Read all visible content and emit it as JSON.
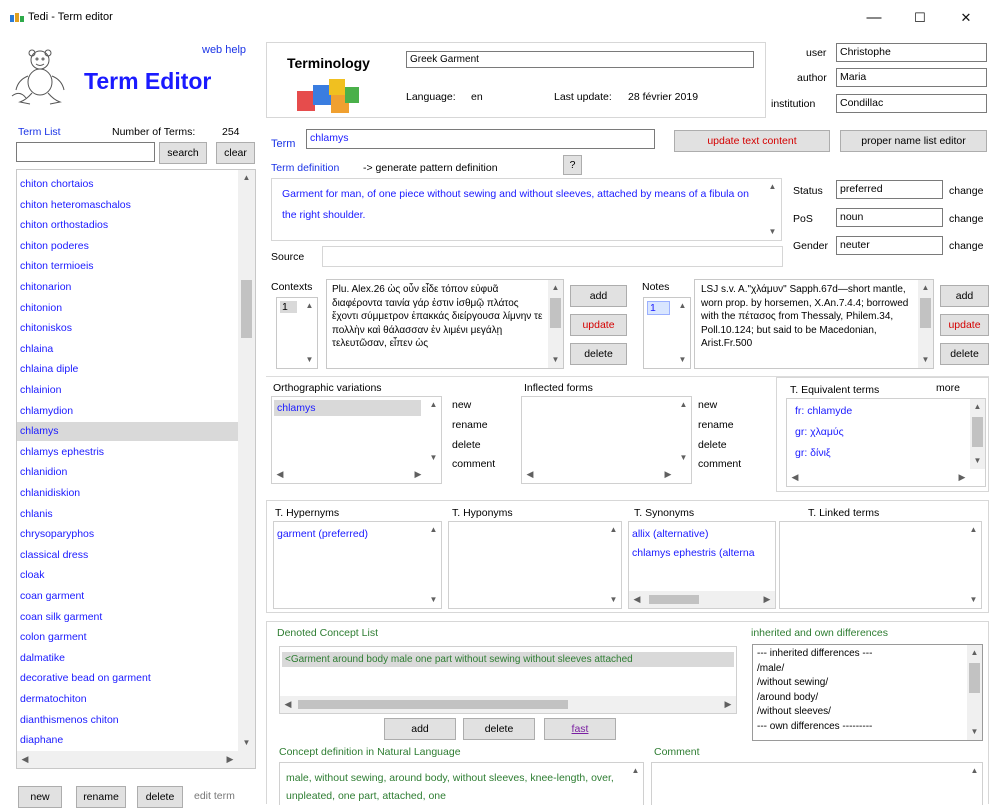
{
  "window": {
    "title": "Tedi - Term editor",
    "minimize": "—",
    "maximize": "☐",
    "close": "✕"
  },
  "left": {
    "web_help": "web help",
    "heading": "Term Editor",
    "term_list_label": "Term List",
    "number_of_terms_label": "Number of Terms:",
    "number_of_terms": "254",
    "search_value": "",
    "search_button": "search",
    "clear_button": "clear",
    "terms": [
      "chiton chortaios",
      "chiton heteromaschalos",
      "chiton orthostadios",
      "chiton poderes",
      "chiton termioeis",
      "chitonarion",
      "chitonion",
      "chitoniskos",
      "chlaina",
      "chlaina diple",
      "chlainion",
      "chlamydion",
      "chlamys",
      "chlamys ephestris",
      "chlanidion",
      "chlanidiskion",
      "chlanis",
      "chrysoparyphos",
      "classical dress",
      "cloak",
      "coan garment",
      "coan silk garment",
      "colon garment",
      "dalmatike",
      "decorative bead on garment",
      "dermatochiton",
      "dianthismenos chiton",
      "diaphane"
    ],
    "selected_index": 12,
    "new_button": "new",
    "rename_button": "rename",
    "delete_button": "delete",
    "edit_term": "edit term"
  },
  "header": {
    "terminology_label": "Terminology",
    "terminology_value": "Greek Garment",
    "language_label": "Language:",
    "language_value": "en",
    "last_update_label": "Last update:",
    "last_update_value": "28 février 2019",
    "user_label": "user",
    "user_value": "Christophe",
    "author_label": "author",
    "author_value": "Maria",
    "institution_label": "institution",
    "institution_value": "Condillac"
  },
  "term": {
    "term_label": "Term",
    "term_value": "chlamys",
    "update_text_button": "update text content",
    "proper_name_button": "proper name list editor",
    "definition_label": "Term definition",
    "generate_pattern": "-> generate pattern definition",
    "help_button": "?",
    "definition_text": "Garment for man, of one piece without sewing and without sleeves, attached by means of a fibula on the right shoulder.",
    "status_label": "Status",
    "status_value": "preferred",
    "pos_label": "PoS",
    "pos_value": "noun",
    "gender_label": "Gender",
    "gender_value": "neuter",
    "change_label": "change",
    "source_label": "Source",
    "source_value": ""
  },
  "contexts": {
    "label": "Contexts",
    "index": "1",
    "text": "Plu. Alex.26 ὡς οὖν εἶδε τόπον εὐφυᾶ διαφέροντα ταινία γάρ ἐστιν ἰσθμῷ πλάτος ἔχοντι σύμμετρον ἐπακκάς διείργουσα λίμνην τε πολλὴν καὶ θάλασσαν ἐν λιμένι μεγάλῃ τελευτῶσαν, εἶπεν ὡς",
    "add": "add",
    "update": "update",
    "delete": "delete"
  },
  "notes": {
    "label": "Notes",
    "index": "1",
    "text": "LSJ s.v. A.\"χλάμυν\" Sapph.67d—short mantle, worn prop. by horsemen, X.An.7.4.4; borrowed with the πέτασος from Thessaly, Philem.34, Poll.10.124; but said to be Macedonian, Arist.Fr.500",
    "add": "add",
    "update": "update",
    "delete": "delete"
  },
  "ortho": {
    "label": "Orthographic variations",
    "items": [
      "chlamys"
    ],
    "new": "new",
    "rename": "rename",
    "delete": "delete",
    "comment": "comment"
  },
  "inflected": {
    "label": "Inflected forms",
    "new": "new",
    "rename": "rename",
    "delete": "delete",
    "comment": "comment"
  },
  "equivalents": {
    "label": "T. Equivalent terms",
    "more": "more",
    "items": [
      "fr: chlamyde",
      "gr: χλαμύς",
      "gr: δίνιξ"
    ]
  },
  "relations": {
    "hypernyms_label": "T. Hypernyms",
    "hypernyms": [
      "garment (preferred)"
    ],
    "hyponyms_label": "T. Hyponyms",
    "synonyms_label": "T. Synonyms",
    "synonyms": [
      "allix (alternative)",
      "chlamys ephestris (alterna"
    ],
    "linked_label": "T. Linked terms"
  },
  "concept": {
    "denoted_label": "Denoted Concept List",
    "denoted_item": "<Garment around body male one part without sewing without sleeves attached",
    "add": "add",
    "delete": "delete",
    "fast": "fast",
    "inherited_label": "inherited and own differences",
    "inherited_lines": [
      "--- inherited differences ---",
      "/male/",
      "/without sewing/",
      "/around body/",
      "/without sleeves/",
      "--- own differences ---------"
    ],
    "nl_label": "Concept definition in Natural Language",
    "nl_text": "male, without sewing, around body, without sleeves, knee-length, over, unpleated, one part, attached, one",
    "comment_label": "Comment"
  },
  "colors": {
    "link_blue": "#1a1aff",
    "green_label": "#2e7d32",
    "red_button_text": "#d40000",
    "selection": "#d9d9d9"
  }
}
